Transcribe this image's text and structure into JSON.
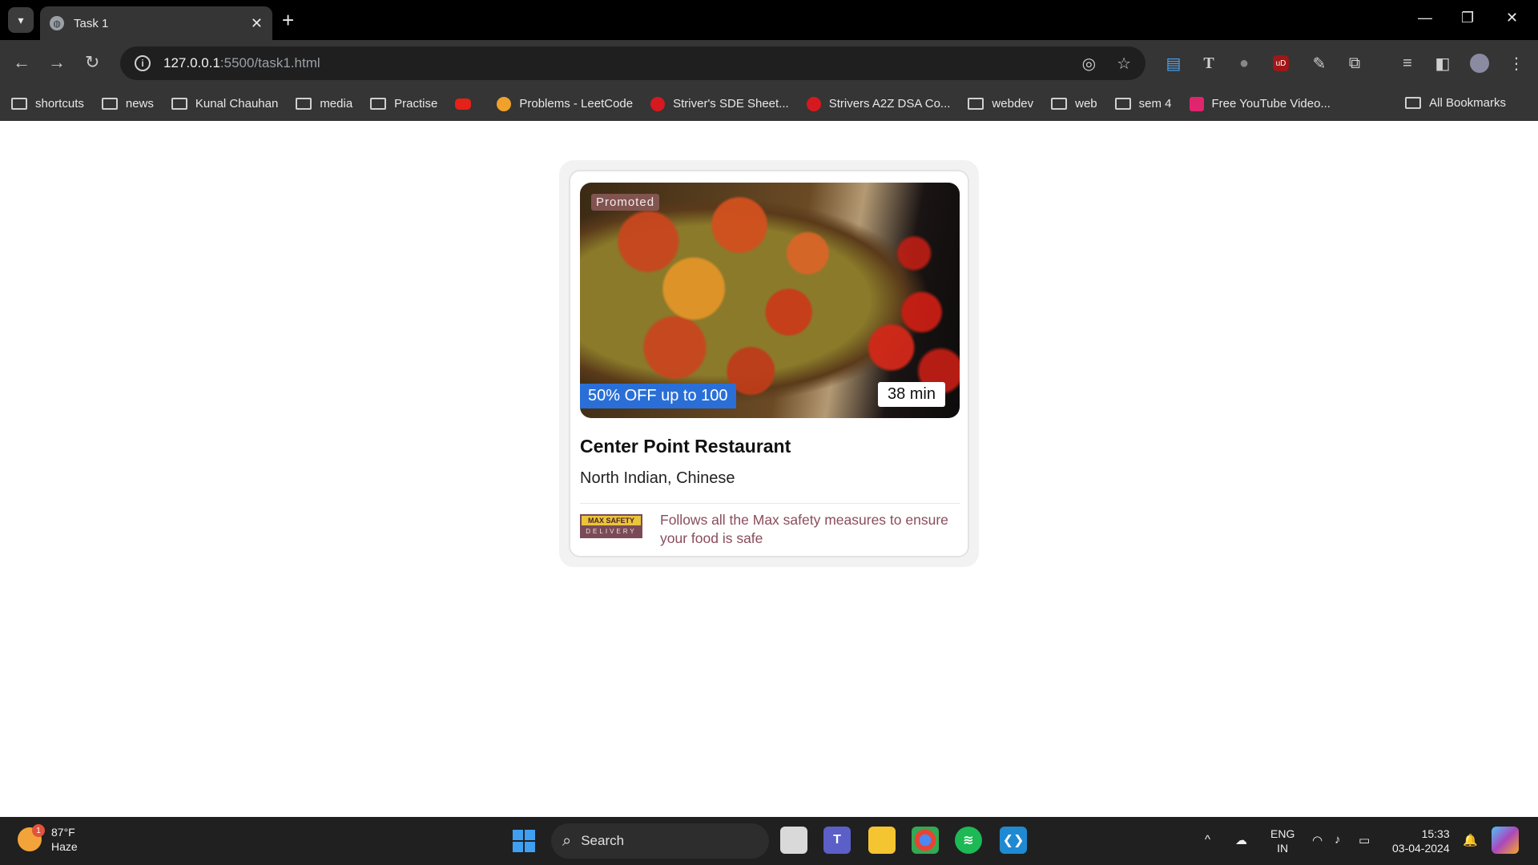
{
  "browser": {
    "tab_title": "Task 1",
    "url_host": "127.0.0.1",
    "url_path": ":5500/task1.html",
    "bookmarks": [
      {
        "label": "shortcuts",
        "icon": "folder-icon"
      },
      {
        "label": "news",
        "icon": "folder-icon"
      },
      {
        "label": "Kunal Chauhan",
        "icon": "folder-icon"
      },
      {
        "label": "media",
        "icon": "folder-icon"
      },
      {
        "label": "Practise",
        "icon": "folder-icon"
      },
      {
        "label": "",
        "icon": "youtube-icon"
      },
      {
        "label": "Problems - LeetCode",
        "icon": "leetcode-icon"
      },
      {
        "label": "Striver's SDE Sheet...",
        "icon": "tuf-icon"
      },
      {
        "label": "Strivers A2Z DSA Co...",
        "icon": "tuf-icon"
      },
      {
        "label": "webdev",
        "icon": "folder-icon"
      },
      {
        "label": "web",
        "icon": "folder-icon"
      },
      {
        "label": "sem 4",
        "icon": "folder-icon"
      },
      {
        "label": "Free YouTube Video...",
        "icon": "video-icon"
      }
    ],
    "all_bookmarks": "All Bookmarks"
  },
  "card": {
    "promoted": "Promoted",
    "discount": "50% OFF up to 100",
    "time": "38 min",
    "name": "Center Point Restaurant",
    "cuisine": "North Indian, Chinese",
    "badge_top": "MAX SAFETY",
    "badge_bottom": "DELIVERY",
    "safety_text": "Follows all the Max safety measures to ensure your food is safe",
    "colors": {
      "discount_bg": "#2a6fd8",
      "safety_text": "#8a4c5c"
    }
  },
  "taskbar": {
    "weather_temp": "87°F",
    "weather_desc": "Haze",
    "weather_badge": "1",
    "search_label": "Search",
    "lang_top": "ENG",
    "lang_bottom": "IN",
    "time": "15:33",
    "date": "03-04-2024"
  }
}
